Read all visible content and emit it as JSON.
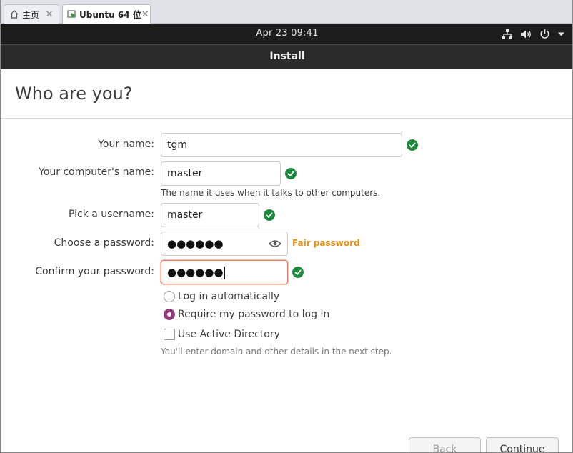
{
  "tabs": [
    {
      "label": "主页",
      "icon": "home-icon",
      "close": "✕"
    },
    {
      "label": "Ubuntu 64 位",
      "icon": "vm-icon",
      "close": "✕"
    }
  ],
  "topbar": {
    "clock": "Apr 23  09:41",
    "icons": [
      "network-icon",
      "volume-icon",
      "power-icon",
      "chevron-down-icon"
    ]
  },
  "window": {
    "title": "Install"
  },
  "page": {
    "heading": "Who are you?"
  },
  "form": {
    "name": {
      "label": "Your name:",
      "value": "tgm"
    },
    "computer": {
      "label": "Your computer's name:",
      "value": "master",
      "hint": "The name it uses when it talks to other computers."
    },
    "username": {
      "label": "Pick a username:",
      "value": "master"
    },
    "password": {
      "label": "Choose a password:",
      "value": "●●●●●●",
      "strength": "Fair password"
    },
    "confirm": {
      "label": "Confirm your password:",
      "value": "●●●●●●"
    }
  },
  "options": {
    "auto_login": {
      "label": "Log in automatically",
      "selected": false
    },
    "require_password": {
      "label": "Require my password to log in",
      "selected": true
    },
    "active_directory": {
      "label": "Use Active Directory",
      "checked": false,
      "hint": "You'll enter domain and other details in the next step."
    }
  },
  "buttons": {
    "back": "Back",
    "continue": "Continue"
  },
  "colors": {
    "accent": "#8e3b77",
    "valid": "#1e8a3d",
    "warning": "#e09016",
    "focus_border": "#e9795a",
    "topbar": "#1d1d1d",
    "header": "#2b2b2b"
  }
}
